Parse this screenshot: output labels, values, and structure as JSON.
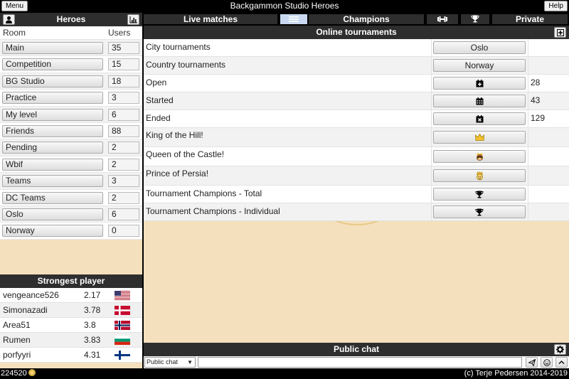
{
  "app": {
    "title": "Backgammon Studio Heroes",
    "menu_label": "Menu",
    "help_label": "Help"
  },
  "heroes": {
    "title": "Heroes",
    "col_room": "Room",
    "col_users": "Users",
    "rooms": [
      {
        "name": "Main",
        "users": "35"
      },
      {
        "name": "Competition",
        "users": "15"
      },
      {
        "name": "BG Studio",
        "users": "18"
      },
      {
        "name": "Practice",
        "users": "3"
      },
      {
        "name": "My level",
        "users": "6"
      },
      {
        "name": "Friends",
        "users": "88"
      },
      {
        "name": "Pending",
        "users": "2"
      },
      {
        "name": "Wbif",
        "users": "2"
      },
      {
        "name": "Teams",
        "users": "3"
      },
      {
        "name": "DC Teams",
        "users": "2"
      },
      {
        "name": "Oslo",
        "users": "6"
      },
      {
        "name": "Norway",
        "users": "0"
      }
    ]
  },
  "strongest": {
    "title": "Strongest player",
    "players": [
      {
        "name": "vengeance526",
        "score": "2.17",
        "flag": "usa-flag-icon"
      },
      {
        "name": "Simonazadi",
        "score": "3.78",
        "flag": "denmark-flag-icon"
      },
      {
        "name": "Area51",
        "score": "3.8",
        "flag": "norway-flag-icon"
      },
      {
        "name": "Rumen",
        "score": "3.83",
        "flag": "bulgaria-flag-icon"
      },
      {
        "name": "porfyyri",
        "score": "4.31",
        "flag": "finland-flag-icon"
      }
    ]
  },
  "nav": {
    "live_matches": "Live matches",
    "list_icon": "list-icon",
    "champions": "Champions",
    "dumbbell_icon": "dumbbell-icon",
    "trophy_icon": "trophy-icon",
    "private": "Private"
  },
  "tournaments": {
    "title": "Online tournaments",
    "rows": [
      {
        "label": "City tournaments",
        "button": "Oslo",
        "icon": "",
        "count": ""
      },
      {
        "label": "Country tournaments",
        "button": "Norway",
        "icon": "",
        "count": ""
      },
      {
        "label": "Open",
        "button": "",
        "icon": "calendar-plus-icon",
        "count": "28"
      },
      {
        "label": "Started",
        "button": "",
        "icon": "calendar-icon",
        "count": "43"
      },
      {
        "label": "Ended",
        "button": "",
        "icon": "calendar-x-icon",
        "count": "129"
      },
      {
        "label": "King of the Hill!",
        "button": "",
        "icon": "crown-icon",
        "count": ""
      },
      {
        "label": "Queen of the Castle!",
        "button": "",
        "icon": "queen-icon",
        "count": ""
      },
      {
        "label": "Prince of Persia!",
        "button": "",
        "icon": "prince-icon",
        "count": ""
      },
      {
        "label": "Tournament Champions - Total",
        "button": "",
        "icon": "trophy-icon",
        "count": ""
      },
      {
        "label": "Tournament Champions - Individual",
        "button": "",
        "icon": "trophy-icon",
        "count": ""
      }
    ]
  },
  "chat": {
    "title": "Public chat",
    "channel": "Public chat",
    "input_value": ""
  },
  "footer": {
    "coins": "224520",
    "copyright": "(c) Terje Pedersen 2014-2019"
  }
}
